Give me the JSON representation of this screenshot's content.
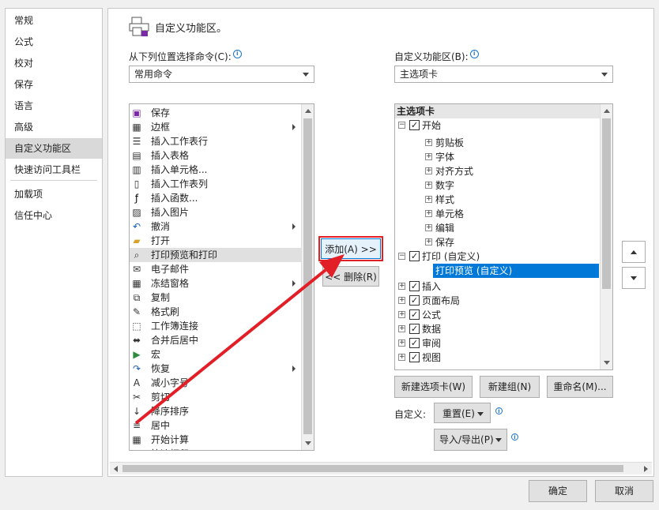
{
  "nav": {
    "items": [
      "常规",
      "公式",
      "校对",
      "保存",
      "语言",
      "高级",
      "自定义功能区",
      "快速访问工具栏",
      "加载项",
      "信任中心"
    ],
    "selected_index": 6
  },
  "header": {
    "title": "自定义功能区。",
    "icon": "customize-ribbon-icon"
  },
  "left": {
    "label": "从下列位置选择命令(C):",
    "combo_value": "常用命令",
    "commands": [
      {
        "label": "保存",
        "icon": "save-icon"
      },
      {
        "label": "边框",
        "icon": "border-icon",
        "submenu": true
      },
      {
        "label": "插入工作表行",
        "icon": "insert-row-icon"
      },
      {
        "label": "插入表格",
        "icon": "insert-table-icon"
      },
      {
        "label": "插入单元格...",
        "icon": "insert-cell-icon"
      },
      {
        "label": "插入工作表列",
        "icon": "insert-column-icon"
      },
      {
        "label": "插入函数...",
        "icon": "function-icon"
      },
      {
        "label": "插入图片",
        "icon": "picture-icon"
      },
      {
        "label": "撤消",
        "icon": "undo-icon",
        "submenu": true
      },
      {
        "label": "打开",
        "icon": "folder-icon"
      },
      {
        "label": "打印预览和打印",
        "icon": "print-preview-icon",
        "selected": true
      },
      {
        "label": "电子邮件",
        "icon": "email-icon"
      },
      {
        "label": "冻结窗格",
        "icon": "freeze-panes-icon",
        "submenu": true
      },
      {
        "label": "复制",
        "icon": "copy-icon"
      },
      {
        "label": "格式刷",
        "icon": "format-painter-icon"
      },
      {
        "label": "工作簿连接",
        "icon": "connections-icon"
      },
      {
        "label": "合并后居中",
        "icon": "merge-center-icon"
      },
      {
        "label": "宏",
        "icon": "macro-icon"
      },
      {
        "label": "恢复",
        "icon": "redo-icon",
        "submenu": true
      },
      {
        "label": "减小字号",
        "icon": "decrease-font-icon"
      },
      {
        "label": "剪切",
        "icon": "cut-icon"
      },
      {
        "label": "降序排序",
        "icon": "sort-desc-icon"
      },
      {
        "label": "居中",
        "icon": "center-icon"
      },
      {
        "label": "开始计算",
        "icon": "calculator-icon"
      },
      {
        "label": "快速打印",
        "icon": "quick-print-icon"
      }
    ]
  },
  "middle": {
    "add_label": "添加(A) >>",
    "remove_label": "<< 删除(R)"
  },
  "right": {
    "label": "自定义功能区(B):",
    "combo_value": "主选项卡",
    "tree_header": "主选项卡",
    "tree": [
      {
        "level": 0,
        "label": "开始",
        "expander": "⊟",
        "checked": true
      },
      {
        "level": 1,
        "label": "剪贴板",
        "expander": "⊞"
      },
      {
        "level": 1,
        "label": "字体",
        "expander": "⊞"
      },
      {
        "level": 1,
        "label": "对齐方式",
        "expander": "⊞"
      },
      {
        "level": 1,
        "label": "数字",
        "expander": "⊞"
      },
      {
        "level": 1,
        "label": "样式",
        "expander": "⊞"
      },
      {
        "level": 1,
        "label": "单元格",
        "expander": "⊞"
      },
      {
        "level": 1,
        "label": "编辑",
        "expander": "⊞"
      },
      {
        "level": 1,
        "label": "保存",
        "expander": "⊞"
      },
      {
        "level": 0,
        "label": "打印 (自定义)",
        "expander": "⊟",
        "checked": true
      },
      {
        "level": 2,
        "label": "打印预览 (自定义)",
        "selected": true
      },
      {
        "level": 0,
        "label": "插入",
        "expander": "⊞",
        "checked": true
      },
      {
        "level": 0,
        "label": "页面布局",
        "expander": "⊞",
        "checked": true
      },
      {
        "level": 0,
        "label": "公式",
        "expander": "⊞",
        "checked": true
      },
      {
        "level": 0,
        "label": "数据",
        "expander": "⊞",
        "checked": true
      },
      {
        "level": 0,
        "label": "审阅",
        "expander": "⊞",
        "checked": true
      },
      {
        "level": 0,
        "label": "视图",
        "expander": "⊞",
        "checked": true
      }
    ],
    "new_tab": "新建选项卡(W)",
    "new_group": "新建组(N)",
    "rename": "重命名(M)...",
    "custom_label": "自定义:",
    "reset": "重置(E)",
    "import_export": "导入/导出(P)"
  },
  "footer": {
    "ok": "确定",
    "cancel": "取消"
  },
  "colors": {
    "selection": "#0078d7",
    "highlight": "#e21f26"
  }
}
